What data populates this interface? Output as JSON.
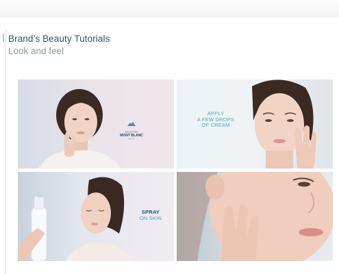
{
  "header": {
    "title": "Brand’s Beauty Tutorials",
    "subtitle": "Look and feel"
  },
  "panels": [
    {
      "id": "panel-1",
      "logo": {
        "brand": "MAISON",
        "brand2": "MONT BLANC",
        "tag": "PARIS"
      }
    },
    {
      "id": "panel-2",
      "overlay_lines": [
        "APPLY",
        "A FEW DROPS",
        "OF CREAM"
      ]
    },
    {
      "id": "panel-3",
      "overlay_main": "SPRAY",
      "overlay_sub": "ON SKIN"
    },
    {
      "id": "panel-4"
    }
  ],
  "colors": {
    "title": "#2c5278",
    "subtitle": "#8a98a6",
    "overlay_accent": "#47a8c4",
    "overlay_dark": "#1e4f7a"
  }
}
